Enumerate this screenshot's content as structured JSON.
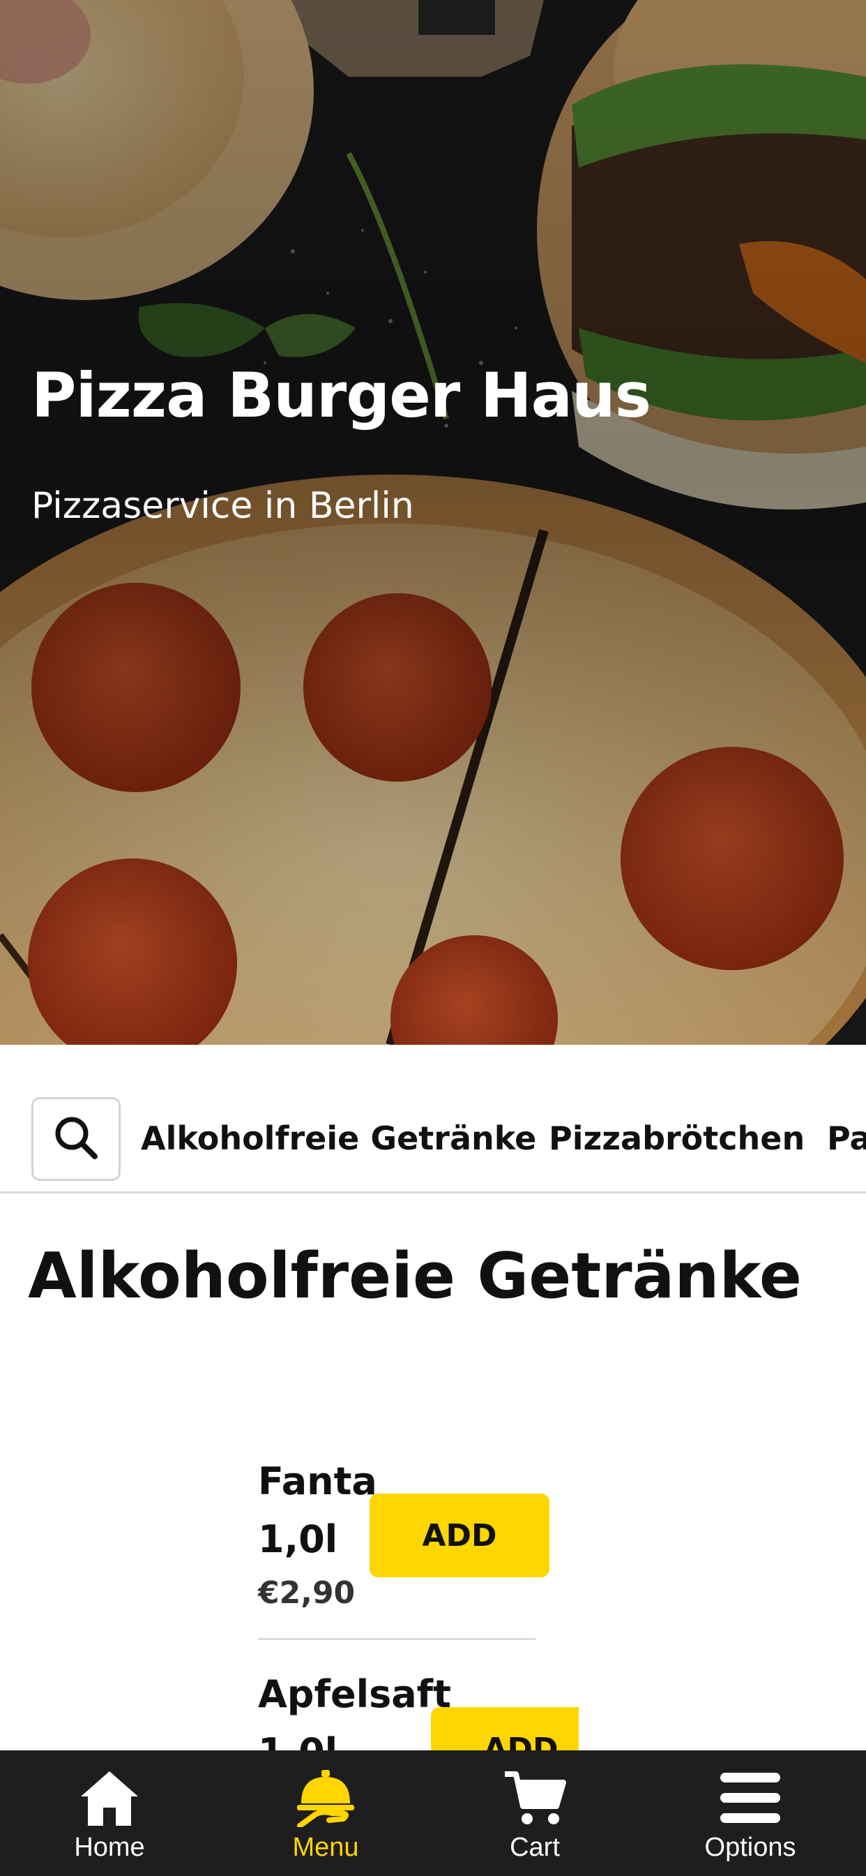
{
  "hero": {
    "title": "Pizza Burger Haus",
    "subtitle": "Pizzaservice in Berlin"
  },
  "category_bar": {
    "search_icon": "search-icon",
    "tabs": [
      {
        "label": "Alkoholfreie Getränke"
      },
      {
        "label": "Pizzabrötchen"
      },
      {
        "label": "Pa"
      }
    ]
  },
  "section": {
    "title": "Alkoholfreie Getränke"
  },
  "items": [
    {
      "name": "Fanta",
      "size": "1,0l",
      "price": "€2,90",
      "add_label": "ADD"
    },
    {
      "name": "Apfelsaft",
      "size": "1,0l",
      "price": "",
      "add_label": "ADD"
    }
  ],
  "bottom_nav": {
    "items": [
      {
        "label": "Home",
        "icon": "home-icon"
      },
      {
        "label": "Menu",
        "icon": "menu-bell-icon",
        "active": true
      },
      {
        "label": "Cart",
        "icon": "cart-icon"
      },
      {
        "label": "Options",
        "icon": "hamburger-icon"
      }
    ]
  },
  "colors": {
    "accent": "#ffd600",
    "nav_background": "#1e1e1e",
    "text": "#111111"
  }
}
